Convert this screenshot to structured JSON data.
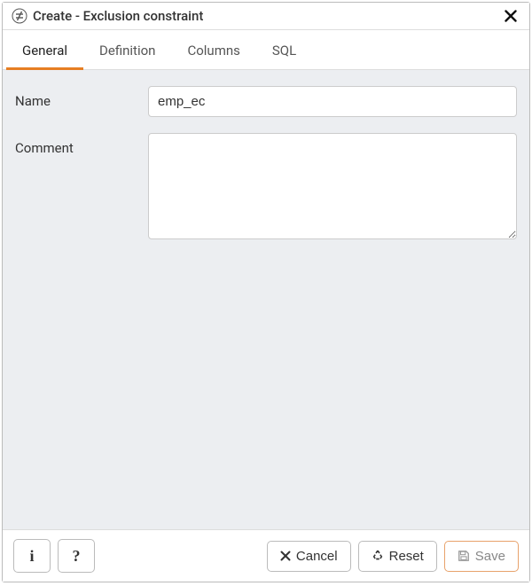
{
  "dialog": {
    "title": "Create - Exclusion constraint"
  },
  "tabs": [
    {
      "label": "General",
      "active": true
    },
    {
      "label": "Definition",
      "active": false
    },
    {
      "label": "Columns",
      "active": false
    },
    {
      "label": "SQL",
      "active": false
    }
  ],
  "form": {
    "name_label": "Name",
    "name_value": "emp_ec",
    "comment_label": "Comment",
    "comment_value": ""
  },
  "footer": {
    "cancel_label": "Cancel",
    "reset_label": "Reset",
    "save_label": "Save"
  },
  "colors": {
    "accent": "#e67e22"
  }
}
